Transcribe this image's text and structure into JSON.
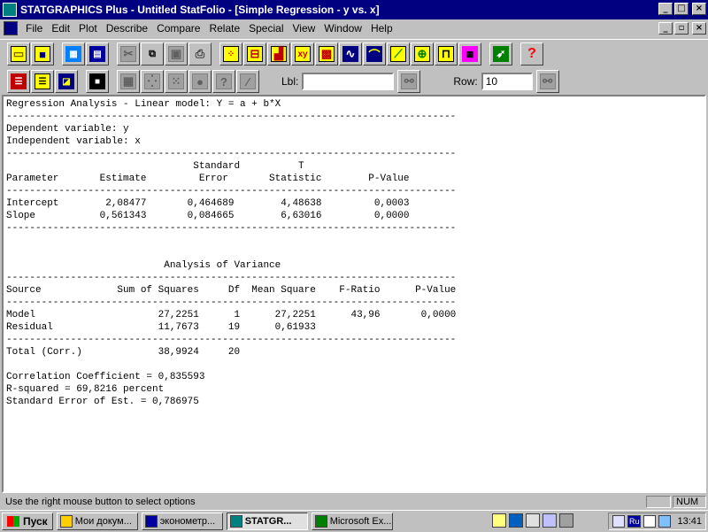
{
  "window": {
    "title": "STATGRAPHICS Plus - Untitled StatFolio - [Simple Regression - y vs. x]"
  },
  "menu": [
    {
      "label": "File"
    },
    {
      "label": "Edit"
    },
    {
      "label": "Plot"
    },
    {
      "label": "Describe"
    },
    {
      "label": "Compare"
    },
    {
      "label": "Relate"
    },
    {
      "label": "Special"
    },
    {
      "label": "View"
    },
    {
      "label": "Window"
    },
    {
      "label": "Help"
    }
  ],
  "toolbar2": {
    "lbl_label": "Lbl:",
    "lbl_value": "",
    "row_label": "Row:",
    "row_value": "10"
  },
  "output": {
    "lines": [
      "Regression Analysis - Linear model: Y = a + b*X",
      "-----------------------------------------------------------------------------",
      "Dependent variable: y",
      "Independent variable: x",
      "-----------------------------------------------------------------------------",
      "                                Standard          T",
      "Parameter       Estimate         Error       Statistic        P-Value",
      "-----------------------------------------------------------------------------",
      "Intercept        2,08477       0,464689        4,48638         0,0003",
      "Slope           0,561343       0,084665        6,63016         0,0000",
      "-----------------------------------------------------------------------------",
      "",
      "",
      "                           Analysis of Variance",
      "-----------------------------------------------------------------------------",
      "Source             Sum of Squares     Df  Mean Square    F-Ratio      P-Value",
      "-----------------------------------------------------------------------------",
      "Model                     27,2251      1      27,2251      43,96       0,0000",
      "Residual                  11,7673     19      0,61933",
      "-----------------------------------------------------------------------------",
      "Total (Corr.)             38,9924     20",
      "",
      "Correlation Coefficient = 0,835593",
      "R-squared = 69,8216 percent",
      "Standard Error of Est. = 0,786975"
    ]
  },
  "status": {
    "text": "Use the right mouse button to select options",
    "panel1": "",
    "panel2": "NUM"
  },
  "taskbar": {
    "start": "Пуск",
    "tasks": [
      {
        "label": "Мои докум...",
        "active": false
      },
      {
        "label": "эконометр...",
        "active": false
      },
      {
        "label": "STATGR...",
        "active": true
      },
      {
        "label": "Microsoft Ex...",
        "active": false
      }
    ],
    "lang": "Ru",
    "clock": "13:41"
  }
}
